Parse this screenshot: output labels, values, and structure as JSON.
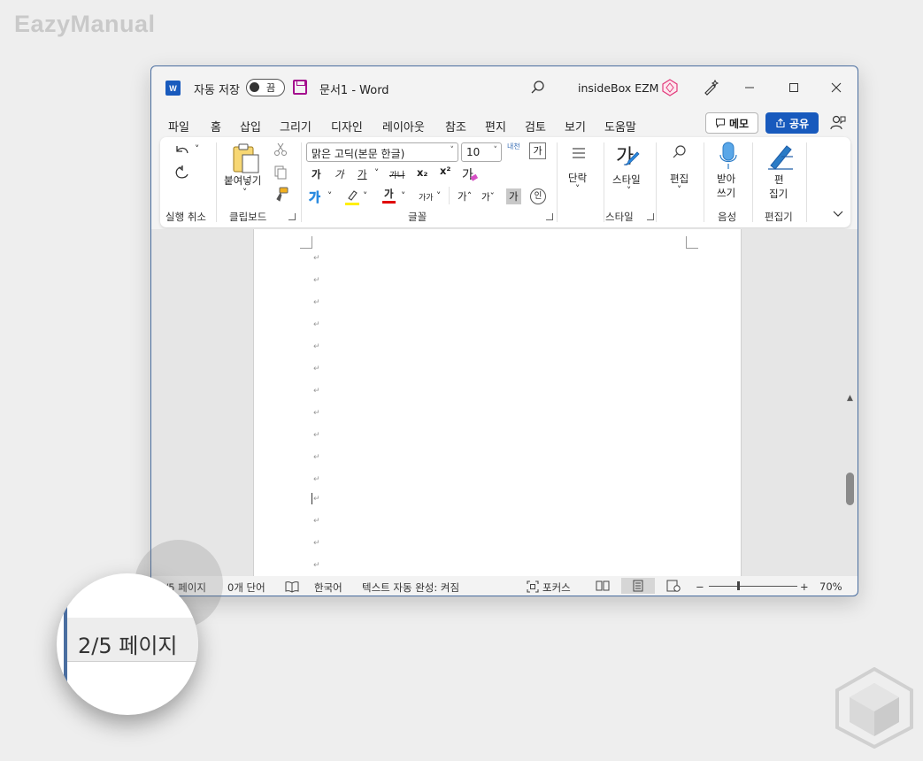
{
  "watermark": "EazyManual",
  "titlebar": {
    "app_icon": "W",
    "autosave_label": "자동 저장",
    "autosave_state": "끔",
    "doc_title": "문서1  -  Word",
    "account_name": "insideBox EZM"
  },
  "menu": {
    "items": [
      "파일",
      "홈",
      "삽입",
      "그리기",
      "디자인",
      "레이아웃",
      "참조",
      "편지",
      "검토",
      "보기",
      "도움말"
    ],
    "memo": "메모",
    "share": "공유"
  },
  "ribbon": {
    "groups": {
      "undo": "실행 취소",
      "clipboard": "클립보드",
      "font": "글꼴",
      "style": "스타일",
      "voice": "음성",
      "editor": "편집기"
    },
    "paste_label": "붙여넣기",
    "font_name": "맑은 고딕(본문 한글)",
    "font_size": "10",
    "bold_glyph": "가",
    "italic_glyph": "가",
    "underline_glyph": "가",
    "strike_glyph": "가나",
    "subscript": "x₂",
    "superscript": "x²",
    "clear_format_glyph": "가",
    "font_color_glyph": "가",
    "phonetic_glyph": "가가",
    "grow_glyph": "가ˆ",
    "shrink_glyph": "가ˇ",
    "char_shading_glyph": "가",
    "enclose_glyph": "인",
    "hanja_glyph": "내천",
    "char_border_glyph": "가",
    "paragraph_label": "단락",
    "style_label": "스타일",
    "style_glyph": "가",
    "editing_label": "편집",
    "dictate_label_1": "받아",
    "dictate_label_2": "쓰기",
    "editor_label_1": "편",
    "editor_label_2": "집기",
    "text_effect_glyph": "가"
  },
  "statusbar": {
    "page": "2/5 페이지",
    "words": "0개 단어",
    "language": "한국어",
    "autocomplete": "텍스트 자동 완성: 켜짐",
    "focus": "포커스",
    "zoom": "70%",
    "zoom_minus": "−",
    "zoom_plus": "+"
  },
  "magnifier_text": "2/5 페이지",
  "accent_color": "#185abd"
}
